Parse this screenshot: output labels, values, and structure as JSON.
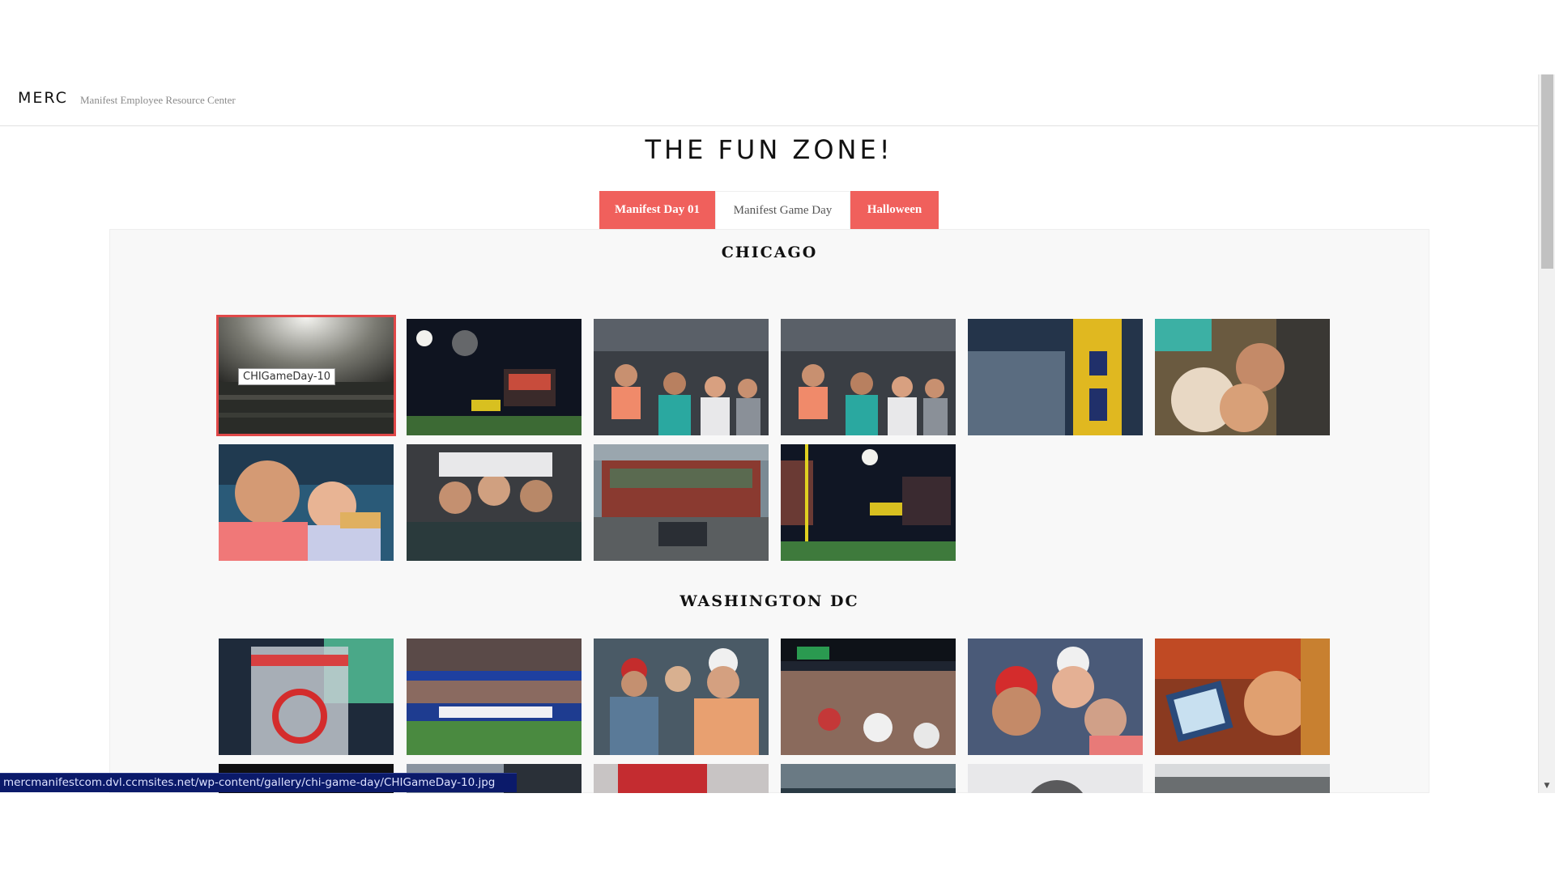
{
  "header": {
    "logo": "MERC",
    "tagline": "Manifest Employee Resource Center"
  },
  "page": {
    "title": "THE FUN ZONE!"
  },
  "tabs": [
    {
      "label": "Manifest Day 01",
      "active": false
    },
    {
      "label": "Manifest Game Day",
      "active": true
    },
    {
      "label": "Halloween",
      "active": false
    }
  ],
  "sections": [
    {
      "heading": "CHICAGO",
      "photos": [
        "stadium-lights",
        "fireworks-scoreboard",
        "fans-group-seats",
        "fans-group-seats",
        "ticket-stub",
        "selfie-couple",
        "selfie-nachos",
        "upside-down-group",
        "trolley-group",
        "fireworks-stadium"
      ]
    },
    {
      "heading": "WASHINGTON DC",
      "photos": [
        "nationals-cup",
        "geico-presidents-race",
        "fans-hats",
        "stadium-crowd",
        "selfie-caps",
        "selfie-tv"
      ]
    }
  ],
  "gallery": {
    "tooltip": "CHIGameDay-10"
  },
  "statusbar": {
    "url": "mercmanifestcom.dvl.ccmsites.net/wp-content/gallery/chi-game-day/CHIGameDay-10.jpg"
  },
  "colors": {
    "accent": "#f0605c",
    "selected_border": "#e04848",
    "statusbar_bg": "#0b1a6a"
  }
}
